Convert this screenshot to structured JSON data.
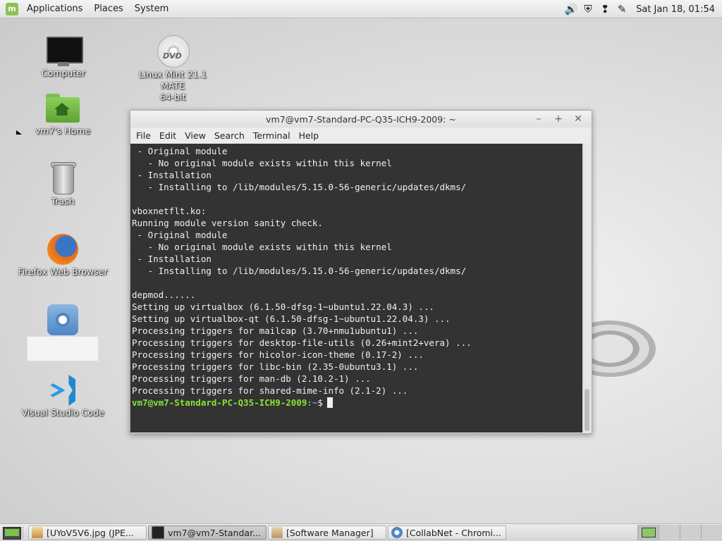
{
  "top_panel": {
    "menus": [
      "Applications",
      "Places",
      "System"
    ],
    "clock": "Sat Jan 18, 01:54"
  },
  "desktop_icons": {
    "computer": "Computer",
    "dvd_line1": "Linux Mint 21.1 MATE",
    "dvd_line2": "64-bit",
    "home": "vm7's Home",
    "trash": "Trash",
    "firefox": "Firefox Web Browser",
    "vscode": "Visual Studio Code"
  },
  "terminal": {
    "title": "vm7@vm7-Standard-PC-Q35-ICH9-2009: ~",
    "menus": [
      "File",
      "Edit",
      "View",
      "Search",
      "Terminal",
      "Help"
    ],
    "lines": [
      " - Original module",
      "   - No original module exists within this kernel",
      " - Installation",
      "   - Installing to /lib/modules/5.15.0-56-generic/updates/dkms/",
      "",
      "vboxnetflt.ko:",
      "Running module version sanity check.",
      " - Original module",
      "   - No original module exists within this kernel",
      " - Installation",
      "   - Installing to /lib/modules/5.15.0-56-generic/updates/dkms/",
      "",
      "depmod......",
      "Setting up virtualbox (6.1.50-dfsg-1~ubuntu1.22.04.3) ...",
      "Setting up virtualbox-qt (6.1.50-dfsg-1~ubuntu1.22.04.3) ...",
      "Processing triggers for mailcap (3.70+nmu1ubuntu1) ...",
      "Processing triggers for desktop-file-utils (0.26+mint2+vera) ...",
      "Processing triggers for hicolor-icon-theme (0.17-2) ...",
      "Processing triggers for libc-bin (2.35-0ubuntu3.1) ...",
      "Processing triggers for man-db (2.10.2-1) ...",
      "Processing triggers for shared-mime-info (2.1-2) ..."
    ],
    "prompt_user": "vm7@vm7-Standard-PC-Q35-ICH9-2009",
    "prompt_path": ":~",
    "prompt_symbol": "$"
  },
  "taskbar": {
    "tasks": [
      "[UYoV5V6.jpg (JPE...",
      "vm7@vm7-Standar...",
      "[Software Manager]",
      "[CollabNet - Chromi..."
    ]
  },
  "colors": {
    "terminal_bg": "#333333",
    "prompt_green": "#8ae234",
    "prompt_blue": "#729fcf",
    "mint_green": "#8dc153"
  }
}
